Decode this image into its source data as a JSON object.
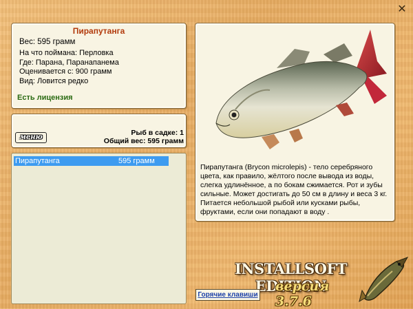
{
  "window": {
    "close_glyph": "✕"
  },
  "info": {
    "fish_name": "Пирапутанга",
    "weight": "Вес: 595 грамм",
    "details": [
      "На что поймана: Перловка",
      "Где: Парана, Паранапанема",
      "Оценивается с: 900 грамм",
      "Вид: Ловится редко"
    ],
    "license": "Есть лицензия"
  },
  "summary": {
    "menu_label": "меню",
    "count_line": "Рыб в садке: 1",
    "total_line": "Общий вес: 595 грамм"
  },
  "catch_list": [
    {
      "name": "Пирапутанга",
      "weight": "595 грамм",
      "selected": true
    }
  ],
  "fish_card": {
    "icon": "fish-illustration",
    "description": "Пирапутанга (Brycon microlepis) - тело серебряного цвета, как правило, жёлтого после вывода из воды, слегка удлинённое, а по бокам сжимается. Рот и зубы сильные. Может достигать до 50 см в длину и веса 3 кг. Питается небольшой рыбой или кусками рыбы, фруктами, если они попадают в воду ."
  },
  "footer": {
    "brand": "INSTALLSOFT EDITION",
    "version": "версия 3.7.6",
    "hotkeys": "Горячие клавиши",
    "logo_icon": "pike-logo"
  },
  "colors": {
    "accent_title": "#b23a0c",
    "license_green": "#2a6a12",
    "selection_blue": "#3d9bf0",
    "link_blue": "#1a3fa8"
  }
}
